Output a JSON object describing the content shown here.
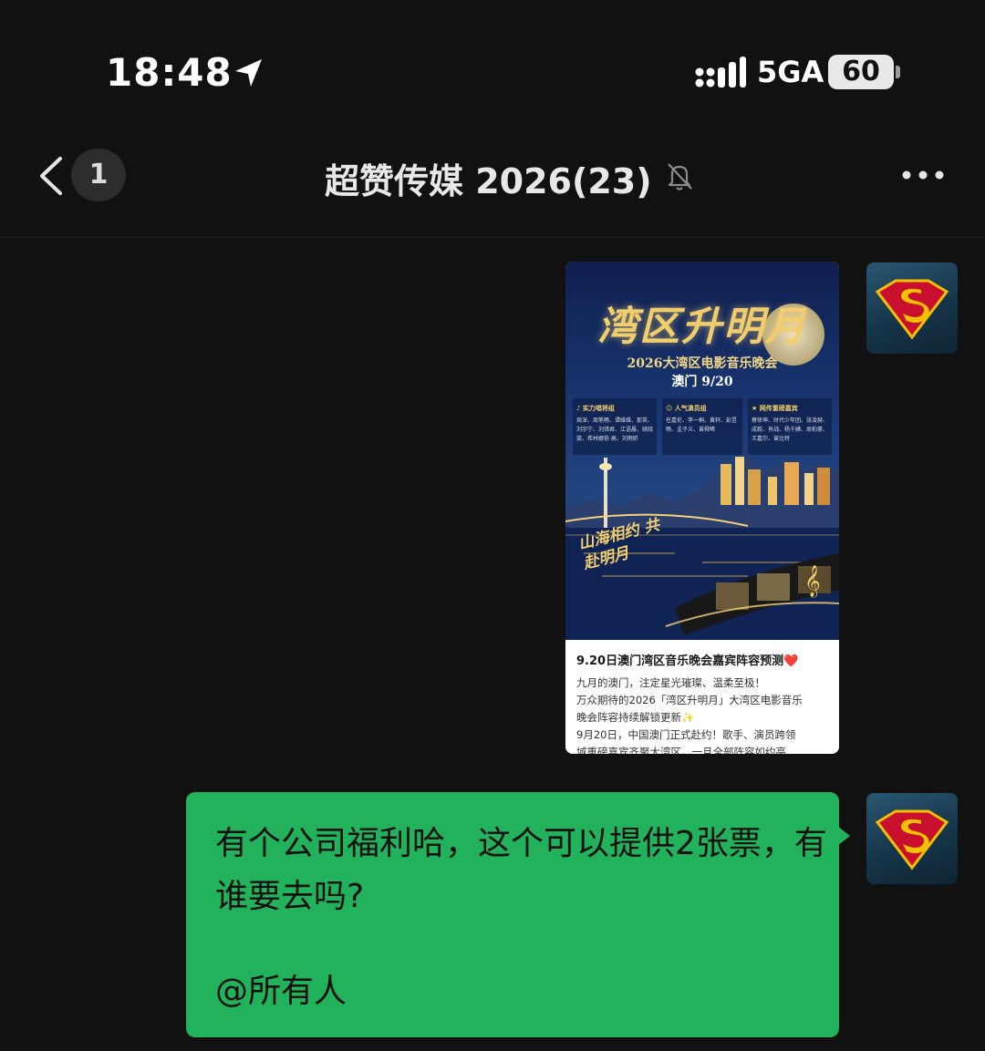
{
  "status_bar": {
    "time": "18:48",
    "network": "5GA",
    "battery": "60"
  },
  "nav": {
    "unread_count": "1",
    "title": "超赞传媒 2026(23)"
  },
  "messages": {
    "image_card": {
      "poster_title": "湾区升明月",
      "poster_subtitle": "2026大湾区电影音乐晚会",
      "poster_date": "澳门 9/20",
      "poster_slogan": "山海相约 共赴明月",
      "columns": [
        {
          "head": "♪ 实力唱将组",
          "body": "周深、周笔畅、谭维维、那英、刘宇宁、刘惜君、江语晨、姚晓棠、希林娜依·高、刘雨昕"
        },
        {
          "head": "☺ 人气演员组",
          "body": "任嘉伦、李一桐、黄轩、彭昱畅、孟子义、曾舜晞"
        },
        {
          "head": "★ 网传重磅嘉宾",
          "body": "蔡徐坤、时代少年团、张凌赫、成毅、肖战、杨千嬅、周柏豪、王嘉尔、曾比特"
        }
      ],
      "headline": "9.20日澳门湾区音乐晚会嘉宾阵容预测❤️",
      "body_lines": [
        "九月的澳门，注定星光璀璨、温柔至极！",
        "万众期待的2026「湾区升明月」大湾区电影音乐",
        "晚会阵容持续解锁更新✨",
        "9月20日，中国澳门正式赴约！歌手、演员跨领",
        "域重磅嘉宾齐聚大湾区，一旦全部阵容如约亮"
      ]
    },
    "text_message": {
      "text": "有个公司福利哈，这个可以提供2张票，有谁要去吗?",
      "mention": "@所有人"
    }
  }
}
